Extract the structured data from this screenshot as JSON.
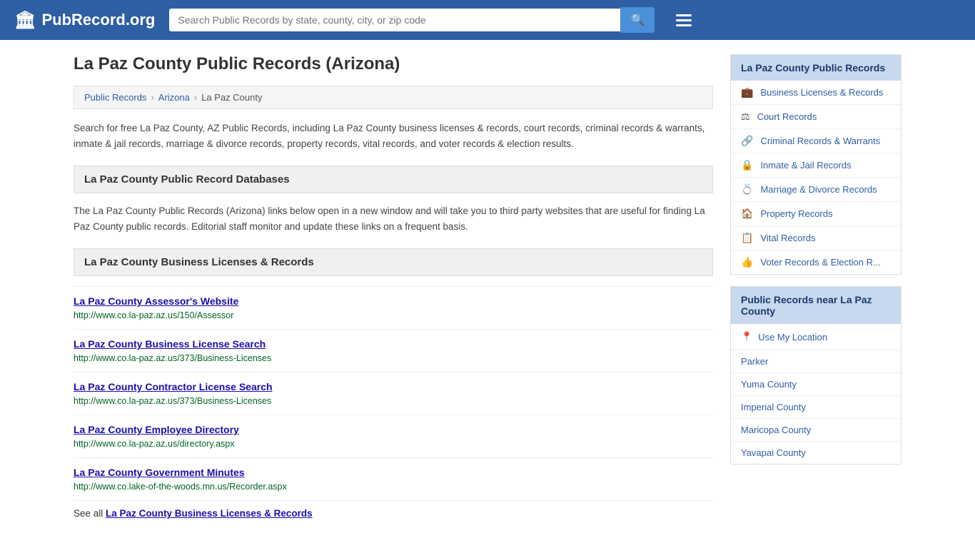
{
  "header": {
    "logo_icon": "🏛",
    "logo_text": "PubRecord.org",
    "search_placeholder": "Search Public Records by state, county, city, or zip code",
    "search_icon": "🔍"
  },
  "page": {
    "title": "La Paz County Public Records (Arizona)",
    "breadcrumb": [
      "Public Records",
      "Arizona",
      "La Paz County"
    ],
    "description": "Search for free La Paz County, AZ Public Records, including La Paz County business licenses & records, court records, criminal records & warrants, inmate & jail records, marriage & divorce records, property records, vital records, and voter records & election results.",
    "databases_header": "La Paz County Public Record Databases",
    "databases_description": "The La Paz County Public Records (Arizona) links below open in a new window and will take you to third party websites that are useful for finding La Paz County public records. Editorial staff monitor and update these links on a frequent basis.",
    "business_header": "La Paz County Business Licenses & Records",
    "records": [
      {
        "title": "La Paz County Assessor's Website",
        "url": "http://www.co.la-paz.az.us/150/Assessor"
      },
      {
        "title": "La Paz County Business License Search",
        "url": "http://www.co.la-paz.az.us/373/Business-Licenses"
      },
      {
        "title": "La Paz County Contractor License Search",
        "url": "http://www.co.la-paz.az.us/373/Business-Licenses"
      },
      {
        "title": "La Paz County Employee Directory",
        "url": "http://www.co.la-paz.az.us/directory.aspx"
      },
      {
        "title": "La Paz County Government Minutes",
        "url": "http://www.co.lake-of-the-woods.mn.us/Recorder.aspx"
      }
    ],
    "see_all_label": "La Paz County Business Licenses & Records",
    "see_all_prefix": "See all"
  },
  "sidebar": {
    "public_records_header": "La Paz County Public Records",
    "links": [
      {
        "icon": "💼",
        "label": "Business Licenses & Records"
      },
      {
        "icon": "⚖",
        "label": "Court Records"
      },
      {
        "icon": "🔗",
        "label": "Criminal Records & Warrants"
      },
      {
        "icon": "🔒",
        "label": "Inmate & Jail Records"
      },
      {
        "icon": "💍",
        "label": "Marriage & Divorce Records"
      },
      {
        "icon": "🏠",
        "label": "Property Records"
      },
      {
        "icon": "📋",
        "label": "Vital Records"
      },
      {
        "icon": "👍",
        "label": "Voter Records & Election R..."
      }
    ],
    "nearby_header": "Public Records near La Paz County",
    "use_location_label": "Use My Location",
    "nearby_places": [
      "Parker",
      "Yuma County",
      "Imperial County",
      "Maricopa County",
      "Yavapai County"
    ]
  }
}
